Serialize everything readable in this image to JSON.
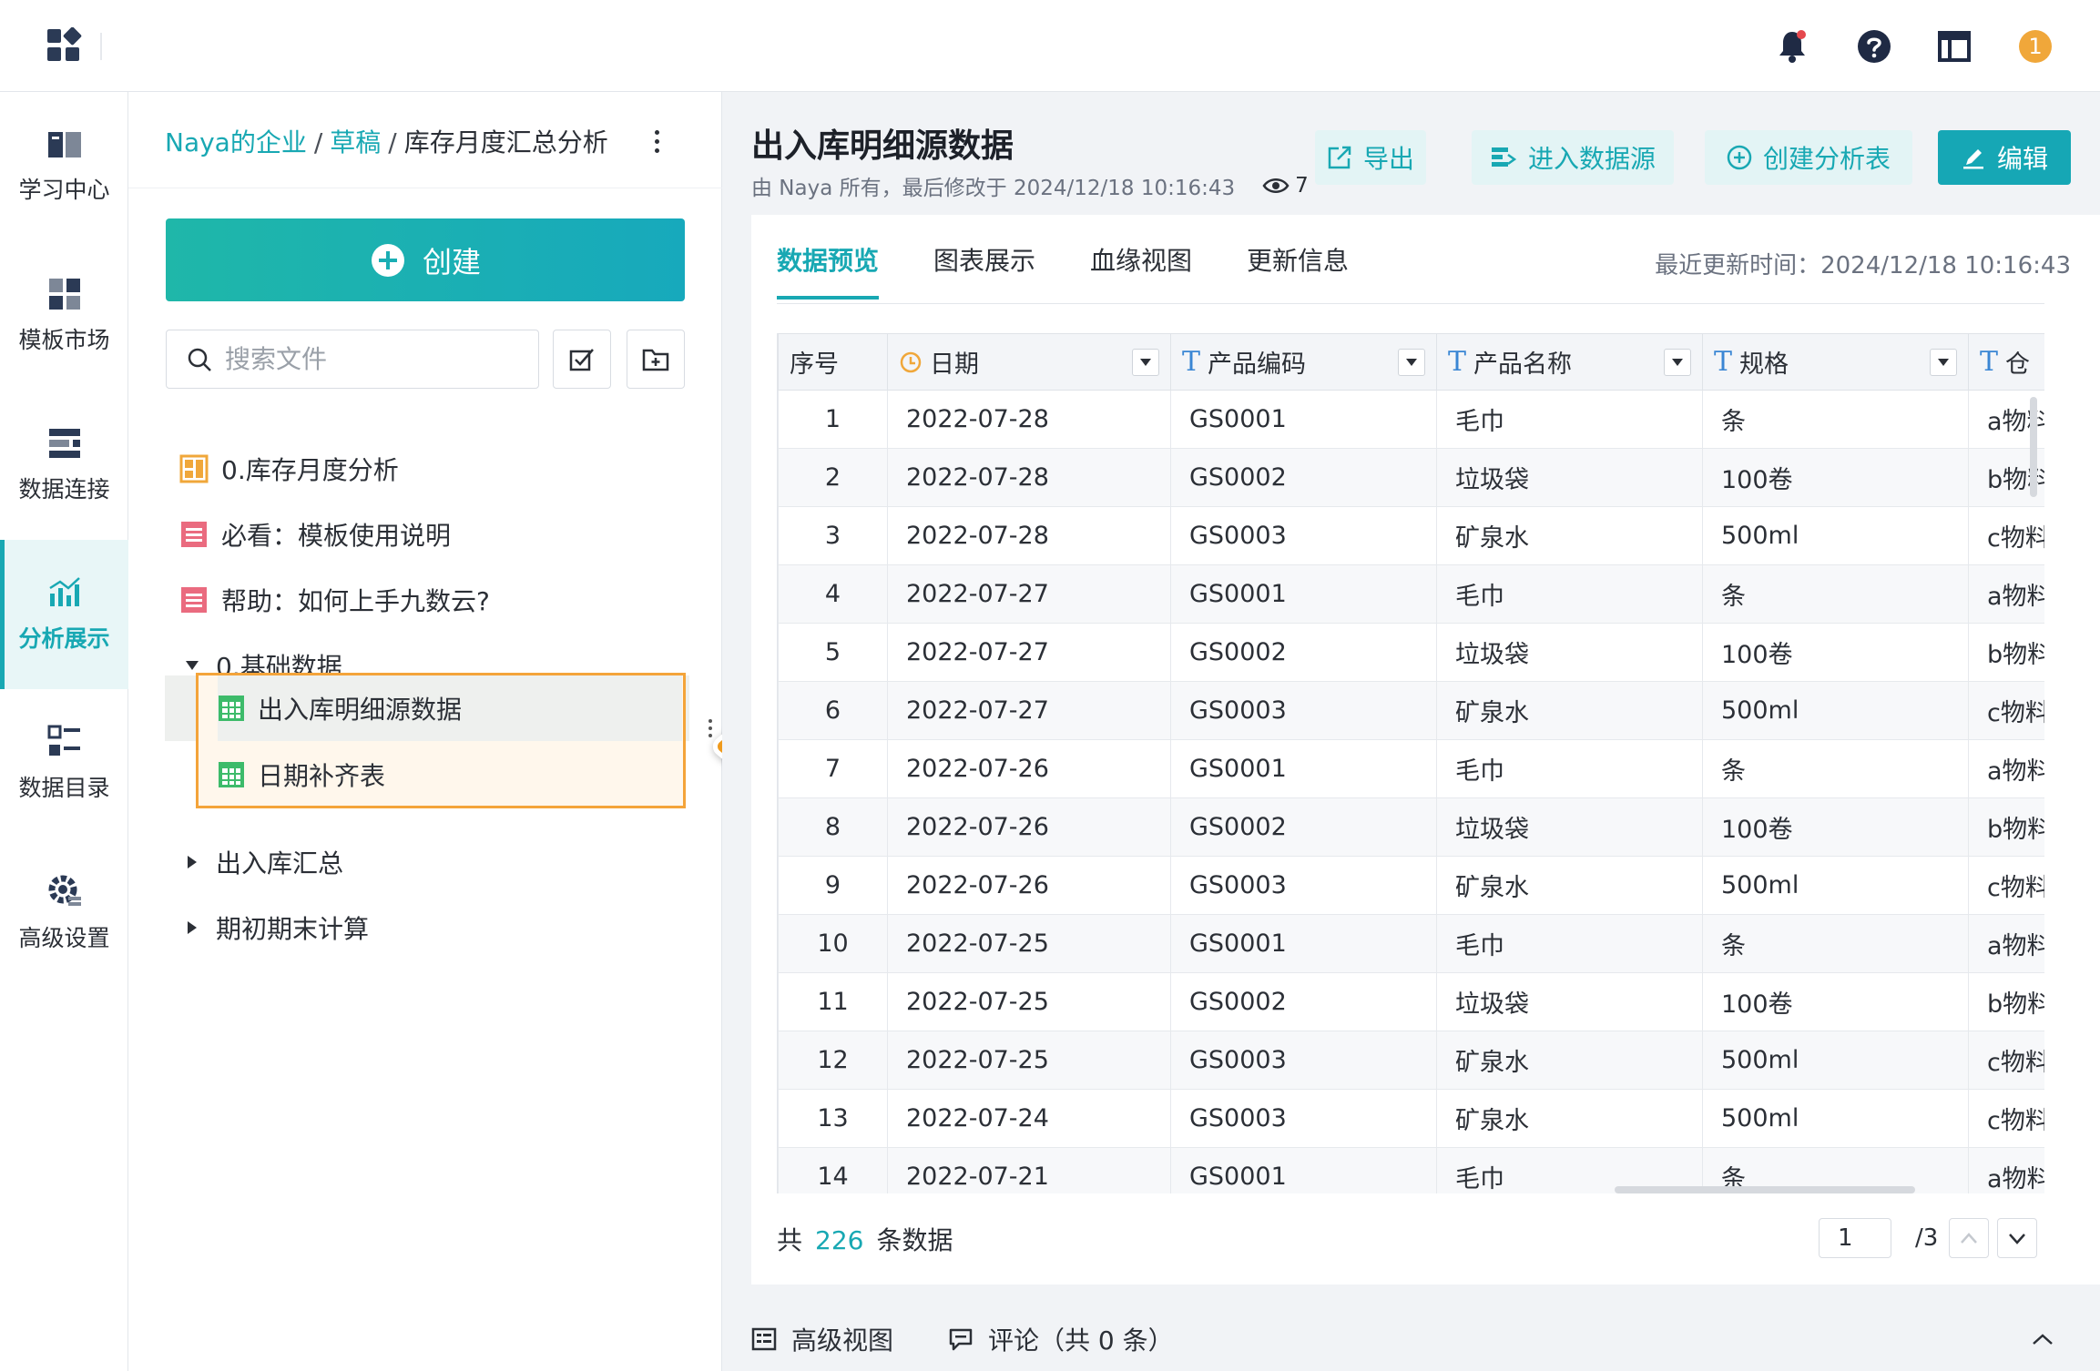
{
  "topbar": {
    "badge_count": "1",
    "icons": [
      "apps-icon",
      "bell-icon",
      "help-icon",
      "layout-icon",
      "user-badge-icon"
    ]
  },
  "leftnav": {
    "items": [
      {
        "label": "学习中心",
        "icon": "book-icon"
      },
      {
        "label": "模板市场",
        "icon": "template-icon"
      },
      {
        "label": "数据连接",
        "icon": "database-icon"
      },
      {
        "label": "分析展示",
        "icon": "chart-icon",
        "active": true
      },
      {
        "label": "数据目录",
        "icon": "catalog-icon"
      },
      {
        "label": "高级设置",
        "icon": "settings-icon"
      }
    ]
  },
  "tree": {
    "breadcrumb": [
      "Naya的企业",
      "草稿",
      "库存月度汇总分析"
    ],
    "create_label": "创建",
    "search_placeholder": "搜索文件",
    "items": [
      {
        "label": "0.库存月度分析",
        "icon": "dashboard-icon"
      },
      {
        "label": "必看：模板使用说明",
        "icon": "doc-icon"
      },
      {
        "label": "帮助：如何上手九数云?",
        "icon": "doc-icon"
      },
      {
        "label": "0.基础数据",
        "icon": "folder-expanded"
      },
      {
        "label": "出入库明细源数据",
        "icon": "table-icon",
        "selected": true
      },
      {
        "label": "日期补齐表",
        "icon": "table-icon"
      },
      {
        "label": "出入库汇总",
        "icon": "folder-collapsed"
      },
      {
        "label": "期初期末计算",
        "icon": "folder-collapsed"
      }
    ]
  },
  "main": {
    "title": "出入库明细源数据",
    "meta": "由 Naya 所有，最后修改于 2024/12/18 10:16:43",
    "view_count": "7",
    "actions": {
      "export": "导出",
      "enter_source": "进入数据源",
      "create_analysis": "创建分析表",
      "edit": "编辑"
    },
    "tabs": [
      "数据预览",
      "图表展示",
      "血缘视图",
      "更新信息"
    ],
    "last_updated": "最近更新时间：2024/12/18 10:16:43",
    "table": {
      "columns": [
        "序号",
        "日期",
        "产品编码",
        "产品名称",
        "规格",
        "仓"
      ],
      "rows": [
        [
          "1",
          "2022-07-28",
          "GS0001",
          "毛巾",
          "条",
          "a物料"
        ],
        [
          "2",
          "2022-07-28",
          "GS0002",
          "垃圾袋",
          "100卷",
          "b物料"
        ],
        [
          "3",
          "2022-07-28",
          "GS0003",
          "矿泉水",
          "500ml",
          "c物料"
        ],
        [
          "4",
          "2022-07-27",
          "GS0001",
          "毛巾",
          "条",
          "a物料"
        ],
        [
          "5",
          "2022-07-27",
          "GS0002",
          "垃圾袋",
          "100卷",
          "b物料"
        ],
        [
          "6",
          "2022-07-27",
          "GS0003",
          "矿泉水",
          "500ml",
          "c物料"
        ],
        [
          "7",
          "2022-07-26",
          "GS0001",
          "毛巾",
          "条",
          "a物料"
        ],
        [
          "8",
          "2022-07-26",
          "GS0002",
          "垃圾袋",
          "100卷",
          "b物料"
        ],
        [
          "9",
          "2022-07-26",
          "GS0003",
          "矿泉水",
          "500ml",
          "c物料"
        ],
        [
          "10",
          "2022-07-25",
          "GS0001",
          "毛巾",
          "条",
          "a物料"
        ],
        [
          "11",
          "2022-07-25",
          "GS0002",
          "垃圾袋",
          "100卷",
          "b物料"
        ],
        [
          "12",
          "2022-07-25",
          "GS0003",
          "矿泉水",
          "500ml",
          "c物料"
        ],
        [
          "13",
          "2022-07-24",
          "GS0003",
          "矿泉水",
          "500ml",
          "c物料"
        ],
        [
          "14",
          "2022-07-21",
          "GS0001",
          "毛巾",
          "条",
          "a物料"
        ]
      ]
    },
    "footer": {
      "prefix": "共",
      "count": "226",
      "suffix": "条数据",
      "page": "1",
      "total_pages": "/3"
    },
    "bottom": {
      "advanced_view": "高级视图",
      "comments": "评论（共 0 条）"
    }
  },
  "colors": {
    "accent": "#18a8b3",
    "highlight": "#f4a43a",
    "badge": "#f0a73a"
  }
}
